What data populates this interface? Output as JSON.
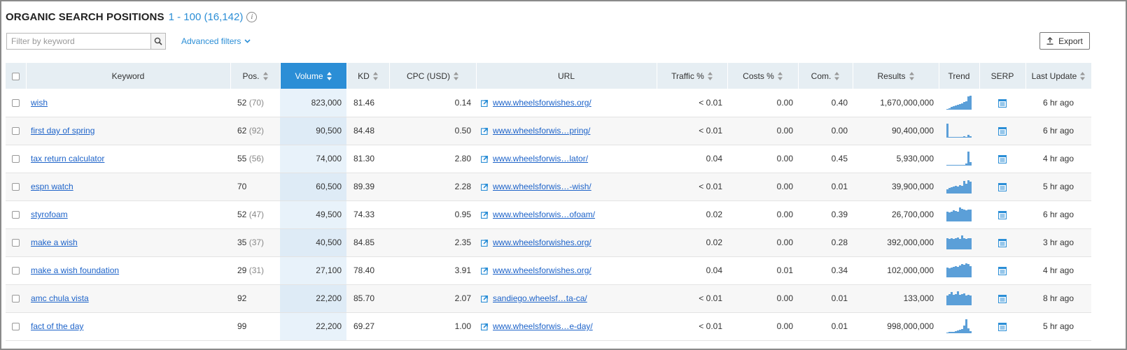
{
  "header": {
    "title": "ORGANIC SEARCH POSITIONS",
    "range": "1 - 100 (16,142)",
    "info_icon": "info-icon"
  },
  "filter": {
    "placeholder": "Filter by keyword",
    "value": "",
    "search_icon": "search-icon",
    "advanced_label": "Advanced filters"
  },
  "export": {
    "label": "Export",
    "icon": "upload-icon"
  },
  "colors": {
    "accent": "#2b8ed6",
    "link": "#1d63c9",
    "header_bg": "#e6eef3",
    "trend_bar": "#5b9fd8"
  },
  "columns": {
    "keyword": "Keyword",
    "pos": "Pos.",
    "volume": "Volume",
    "kd": "KD",
    "cpc": "CPC (USD)",
    "url": "URL",
    "traffic": "Traffic %",
    "costs": "Costs %",
    "com": "Com.",
    "results": "Results",
    "trend": "Trend",
    "serp": "SERP",
    "last_update": "Last Update"
  },
  "rows": [
    {
      "keyword": "wish",
      "pos": "52",
      "prev": "(70)",
      "volume": "823,000",
      "kd": "81.46",
      "cpc": "0.14",
      "url": "www.wheelsforwishes.org/",
      "traffic": "< 0.01",
      "costs": "0.00",
      "com": "0.40",
      "results": "1,670,000,000",
      "trend": [
        0.05,
        0.12,
        0.18,
        0.25,
        0.3,
        0.35,
        0.4,
        0.45,
        0.55,
        0.6,
        0.95,
        1.0
      ],
      "last_update": "6 hr ago"
    },
    {
      "keyword": "first day of spring",
      "pos": "62",
      "prev": "(92)",
      "volume": "90,500",
      "kd": "84.48",
      "cpc": "0.50",
      "url": "www.wheelsforwis…pring/",
      "traffic": "< 0.01",
      "costs": "0.00",
      "com": "0.00",
      "results": "90,400,000",
      "trend": [
        1.0,
        0.05,
        0.02,
        0.02,
        0.02,
        0.02,
        0.02,
        0.02,
        0.1,
        0.05,
        0.2,
        0.1
      ],
      "last_update": "6 hr ago"
    },
    {
      "keyword": "tax return calculator",
      "pos": "55",
      "prev": "(56)",
      "volume": "74,000",
      "kd": "81.30",
      "cpc": "2.80",
      "url": "www.wheelsforwis…lator/",
      "traffic": "0.04",
      "costs": "0.00",
      "com": "0.45",
      "results": "5,930,000",
      "trend": [
        0.05,
        0.02,
        0.02,
        0.02,
        0.02,
        0.02,
        0.02,
        0.02,
        0.02,
        0.15,
        1.0,
        0.25
      ],
      "last_update": "4 hr ago"
    },
    {
      "keyword": "espn watch",
      "pos": "70",
      "prev": "",
      "volume": "60,500",
      "kd": "89.39",
      "cpc": "2.28",
      "url": "www.wheelsforwis…-wish/",
      "traffic": "< 0.01",
      "costs": "0.00",
      "com": "0.01",
      "results": "39,900,000",
      "trend": [
        0.3,
        0.4,
        0.45,
        0.5,
        0.55,
        0.5,
        0.6,
        0.55,
        0.9,
        0.7,
        0.95,
        0.85
      ],
      "last_update": "5 hr ago"
    },
    {
      "keyword": "styrofoam",
      "pos": "52",
      "prev": "(47)",
      "volume": "49,500",
      "kd": "74.33",
      "cpc": "0.95",
      "url": "www.wheelsforwis…ofoam/",
      "traffic": "0.02",
      "costs": "0.00",
      "com": "0.39",
      "results": "26,700,000",
      "trend": [
        0.7,
        0.65,
        0.7,
        0.8,
        0.75,
        0.7,
        1.0,
        0.9,
        0.85,
        0.8,
        0.85,
        0.85
      ],
      "last_update": "6 hr ago"
    },
    {
      "keyword": "make a wish",
      "pos": "35",
      "prev": "(37)",
      "volume": "40,500",
      "kd": "84.85",
      "cpc": "2.35",
      "url": "www.wheelsforwishes.org/",
      "traffic": "0.02",
      "costs": "0.00",
      "com": "0.28",
      "results": "392,000,000",
      "trend": [
        0.8,
        0.75,
        0.8,
        0.75,
        0.8,
        0.85,
        0.75,
        1.0,
        0.8,
        0.75,
        0.8,
        0.8
      ],
      "last_update": "3 hr ago"
    },
    {
      "keyword": "make a wish foundation",
      "pos": "29",
      "prev": "(31)",
      "volume": "27,100",
      "kd": "78.40",
      "cpc": "3.91",
      "url": "www.wheelsforwishes.org/",
      "traffic": "0.04",
      "costs": "0.01",
      "com": "0.34",
      "results": "102,000,000",
      "trend": [
        0.7,
        0.65,
        0.7,
        0.75,
        0.8,
        0.75,
        0.85,
        0.95,
        0.9,
        1.0,
        0.95,
        0.8
      ],
      "last_update": "4 hr ago"
    },
    {
      "keyword": "amc chula vista",
      "pos": "92",
      "prev": "",
      "volume": "22,200",
      "kd": "85.70",
      "cpc": "2.07",
      "url": "sandiego.wheelsf…ta-ca/",
      "traffic": "< 0.01",
      "costs": "0.00",
      "com": "0.01",
      "results": "133,000",
      "trend": [
        0.7,
        0.8,
        0.95,
        0.75,
        0.8,
        1.0,
        0.75,
        0.8,
        0.85,
        0.7,
        0.75,
        0.7
      ],
      "last_update": "8 hr ago"
    },
    {
      "keyword": "fact of the day",
      "pos": "99",
      "prev": "",
      "volume": "22,200",
      "kd": "69.27",
      "cpc": "1.00",
      "url": "www.wheelsforwis…e-day/",
      "traffic": "< 0.01",
      "costs": "0.00",
      "com": "0.01",
      "results": "998,000,000",
      "trend": [
        0.05,
        0.1,
        0.1,
        0.12,
        0.15,
        0.2,
        0.25,
        0.3,
        0.55,
        1.0,
        0.35,
        0.15
      ],
      "last_update": "5 hr ago"
    }
  ]
}
